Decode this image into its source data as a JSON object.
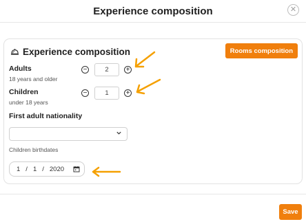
{
  "modal": {
    "title": "Experience composition",
    "close_symbol": "✕"
  },
  "card": {
    "title": "Experience composition",
    "icon": "bell-icon",
    "rooms_button": "Rooms composition"
  },
  "adults": {
    "label": "Adults",
    "sublabel": "18 years and older",
    "value": "2"
  },
  "children": {
    "label": "Children",
    "sublabel": "under 18 years",
    "value": "1"
  },
  "nationality": {
    "label": "First adult nationality",
    "value": ""
  },
  "birthdates": {
    "label": "Children birthdates",
    "day": "1",
    "month": "1",
    "year": "2020",
    "separator": "/"
  },
  "footer": {
    "save_label": "Save"
  },
  "colors": {
    "accent": "#f07f0d",
    "annotation_arrow": "#f5a000"
  }
}
